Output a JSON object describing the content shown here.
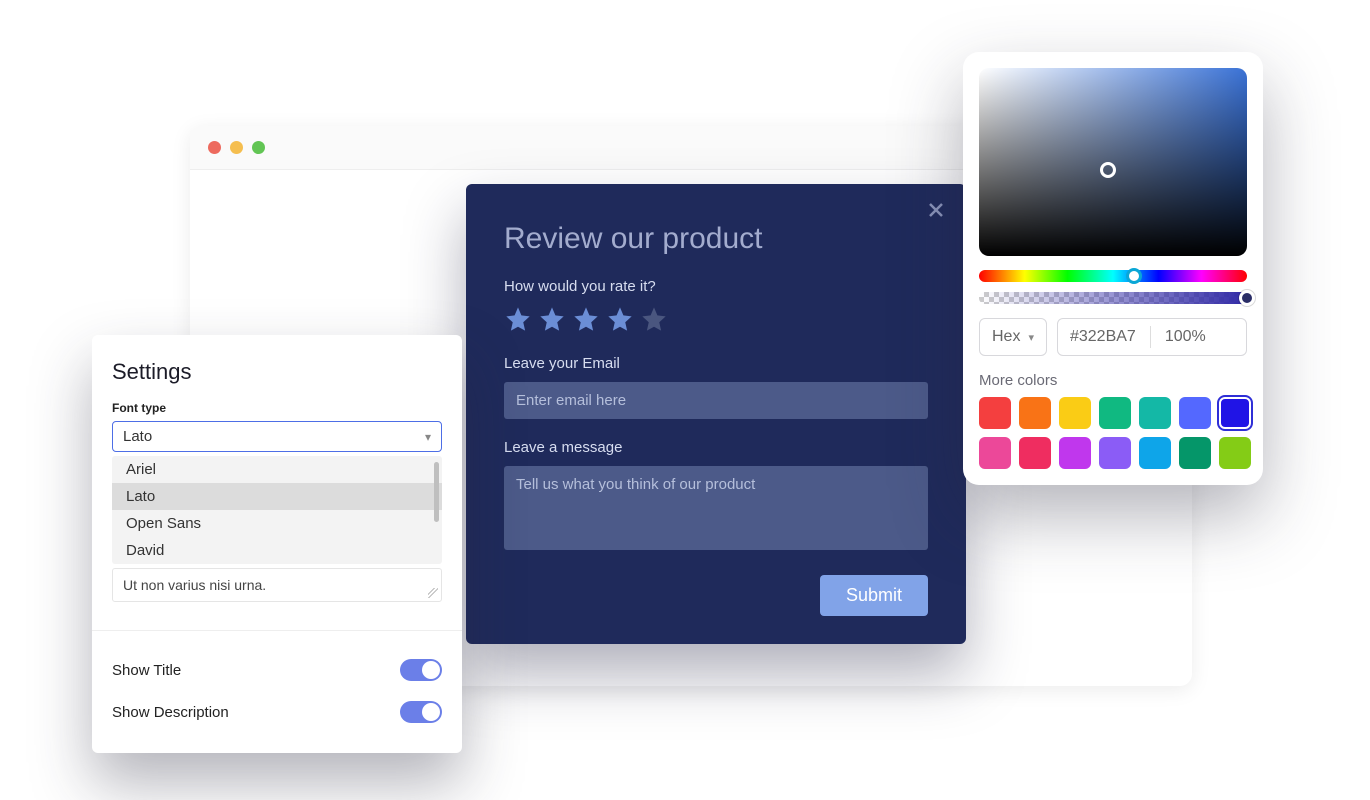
{
  "review": {
    "title": "Review our product",
    "rate_label": "How would you rate it?",
    "stars_filled": 4,
    "stars_total": 5,
    "email_label": "Leave your Email",
    "email_placeholder": "Enter email here",
    "message_label": "Leave a message",
    "message_placeholder": "Tell us what you think of our product",
    "submit_label": "Submit"
  },
  "settings": {
    "title": "Settings",
    "font_type_label": "Font type",
    "font_selected": "Lato",
    "font_options": [
      "Ariel",
      "Lato",
      "Open Sans",
      "David"
    ],
    "description_text": "Ut non varius nisi urna.",
    "show_title_label": "Show Title",
    "show_title_on": true,
    "show_description_label": "Show Description",
    "show_description_on": true
  },
  "picker": {
    "format_label": "Hex",
    "hex_value": "#322BA7",
    "opacity_value": "100%",
    "more_colors_label": "More colors",
    "swatches": [
      {
        "color": "#f43f3f",
        "selected": false
      },
      {
        "color": "#f97316",
        "selected": false
      },
      {
        "color": "#facc15",
        "selected": false
      },
      {
        "color": "#10b981",
        "selected": false
      },
      {
        "color": "#14b8a6",
        "selected": false
      },
      {
        "color": "#5468ff",
        "selected": false
      },
      {
        "color": "#2014e6",
        "selected": true
      },
      {
        "color": "#ec4899",
        "selected": false
      },
      {
        "color": "#ef2d60",
        "selected": false
      },
      {
        "color": "#c037ed",
        "selected": false
      },
      {
        "color": "#8b5cf6",
        "selected": false
      },
      {
        "color": "#0ea5e9",
        "selected": false
      },
      {
        "color": "#059669",
        "selected": false
      },
      {
        "color": "#84cc16",
        "selected": false
      }
    ]
  }
}
